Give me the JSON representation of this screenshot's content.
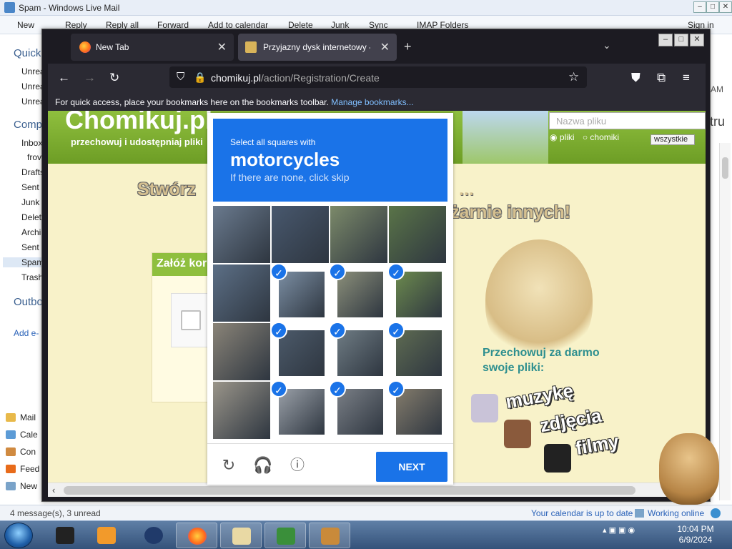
{
  "wlm": {
    "title": "Spam - Windows Live Mail",
    "menu": [
      "New",
      "Reply",
      "Reply all",
      "Forward",
      "Add to calendar",
      "Delete",
      "Junk",
      "Sync",
      "IMAP Folders"
    ],
    "sign_in": "Sign in",
    "sidebar": {
      "quick": "Quick",
      "quick_items": [
        "Unrea",
        "Unrea",
        "Unrea"
      ],
      "comp": "Comp",
      "folders": [
        "Inbox",
        "frov",
        "Drafts",
        "Sent",
        "Junk",
        "Delet",
        "Archi",
        "Sent",
        "Spam",
        "Trash"
      ],
      "outbox": "Outbo",
      "add": "Add e-",
      "nav": [
        "Mail",
        "Cale",
        "Con",
        "Feed",
        "New"
      ]
    },
    "right_labels": {
      "am": "AM",
      "tru": "tru"
    },
    "status_left": "4 message(s), 3 unread",
    "status_calendar": "Your calendar is up to date",
    "status_online": "Working online"
  },
  "firefox": {
    "tabs": [
      {
        "label": "New Tab"
      },
      {
        "label": "Przyjazny dysk internetowy - Ch"
      }
    ],
    "url_host": "chomikuj.pl",
    "url_path": "/action/Registration/Create",
    "bookmarks_text": "For quick access, place your bookmarks here on the bookmarks toolbar.",
    "bookmarks_link": "Manage bookmarks..."
  },
  "page": {
    "logo": "Chomikuj.pl",
    "tagline": "przechowuj i udostępniaj pliki",
    "search_placeholder": "Nazwa pliku",
    "radio_files": "pliki",
    "radio_users": "chomiki",
    "select_value": "wszystkie",
    "title_left": "Stwórz",
    "title_dots": "...",
    "title_right": "iżarnie innych!",
    "register_head": "Załóż kor",
    "promo_line1": "Przechowuj za darmo",
    "promo_line2": "swoje pliki:",
    "words": [
      "muzykę",
      "zdjęcia",
      "filmy"
    ]
  },
  "captcha": {
    "instruction": "Select all squares with",
    "target": "motorcycles",
    "hint": "If there are none, click skip",
    "next_label": "NEXT",
    "selected": [
      false,
      false,
      false,
      false,
      false,
      true,
      true,
      true,
      false,
      true,
      true,
      true,
      false,
      true,
      true,
      true
    ],
    "check_glyph": "✓"
  },
  "taskbar": {
    "time": "10:04 PM",
    "date": "6/9/2024"
  }
}
